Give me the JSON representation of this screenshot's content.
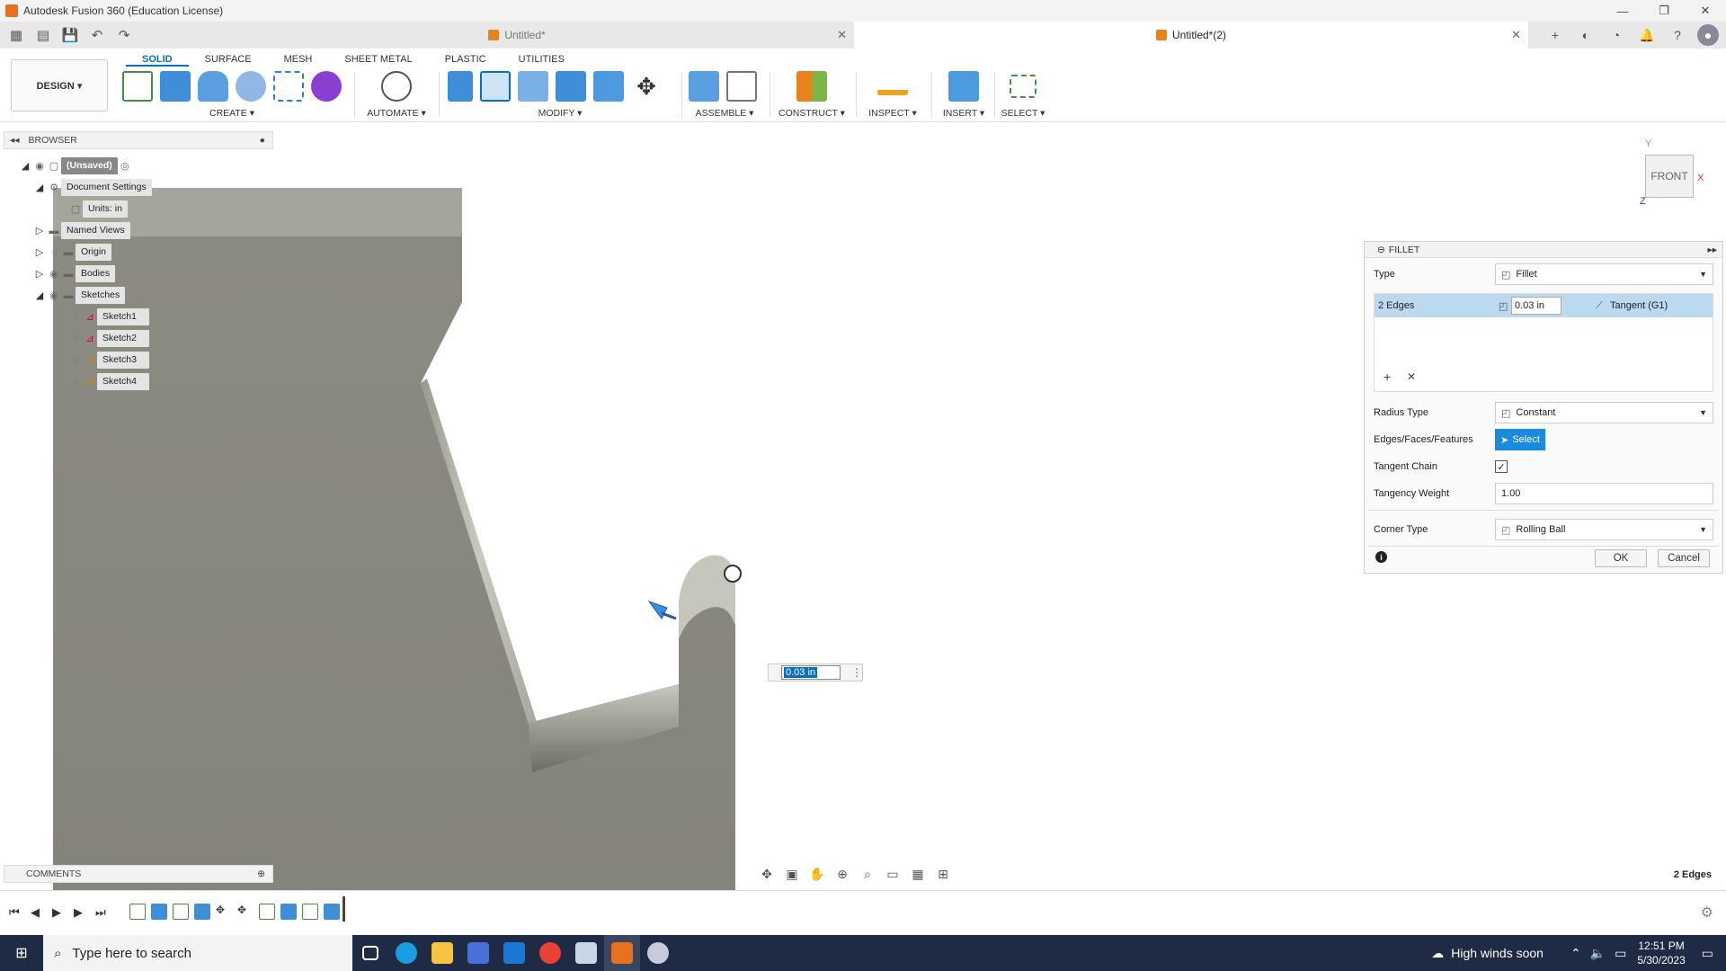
{
  "titlebar": {
    "title": "Autodesk Fusion 360 (Education License)"
  },
  "tabs": [
    {
      "label": "Untitled*"
    },
    {
      "label": "Untitled*(2)"
    }
  ],
  "ribbon": {
    "workspace": "DESIGN ▾",
    "tabs": [
      "SOLID",
      "SURFACE",
      "MESH",
      "SHEET METAL",
      "PLASTIC",
      "UTILITIES"
    ],
    "groups": [
      "CREATE ▾",
      "AUTOMATE ▾",
      "MODIFY ▾",
      "ASSEMBLE ▾",
      "CONSTRUCT ▾",
      "INSPECT ▾",
      "INSERT ▾",
      "SELECT ▾"
    ]
  },
  "browser": {
    "title": "BROWSER",
    "root": "(Unsaved)",
    "doc_settings": "Document Settings",
    "units": "Units: in",
    "named_views": "Named Views",
    "origin": "Origin",
    "bodies": "Bodies",
    "sketches": "Sketches",
    "sketch_items": [
      "Sketch1",
      "Sketch2",
      "Sketch3",
      "Sketch4"
    ]
  },
  "comments": {
    "title": "COMMENTS"
  },
  "viewcube": {
    "face": "FRONT",
    "axis_y": "Y",
    "axis_x": "X",
    "axis_z": "Z"
  },
  "fillet": {
    "title": "FILLET",
    "type_label": "Type",
    "type_value": "Fillet",
    "edges_label": "2 Edges",
    "edges_radius": "0.03 in",
    "edges_continuity": "Tangent (G1)",
    "radius_type_label": "Radius Type",
    "radius_type_value": "Constant",
    "edges_faces_label": "Edges/Faces/Features",
    "select_label": "Select",
    "tangent_chain_label": "Tangent Chain",
    "tangency_weight_label": "Tangency Weight",
    "tangency_weight_value": "1.00",
    "corner_type_label": "Corner Type",
    "corner_type_value": "Rolling Ball",
    "ok": "OK",
    "cancel": "Cancel"
  },
  "dimension_input": {
    "value": "0.03 in"
  },
  "status": {
    "selection": "2 Edges"
  },
  "taskbar": {
    "search_placeholder": "Type here to search",
    "weather": "High winds soon",
    "time": "12:51 PM",
    "date": "5/30/2023"
  },
  "colors": {
    "accent": "#0a6ebd",
    "model_face": "#8a897f",
    "selected_row": "#bcd9f2",
    "taskbar": "#1f2a44"
  }
}
